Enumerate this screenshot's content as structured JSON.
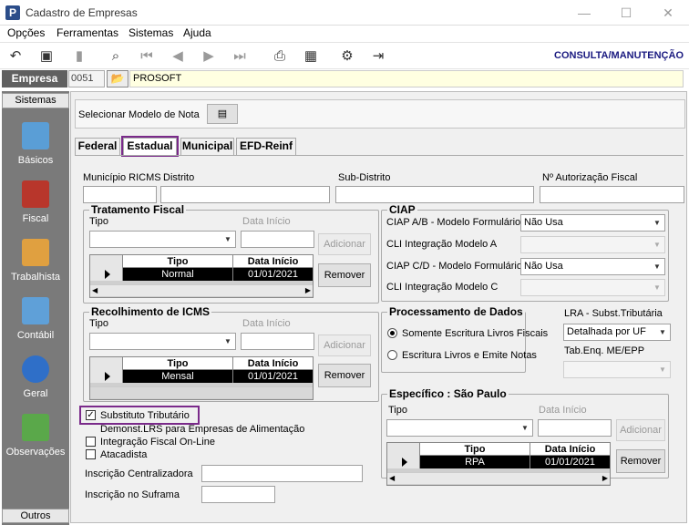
{
  "window": {
    "title": "Cadastro de Empresas",
    "app_glyph": "P"
  },
  "menu": [
    "Opções",
    "Ferramentas",
    "Sistemas",
    "Ajuda"
  ],
  "toolbar": {
    "mode_label": "CONSULTA/MANUTENÇÃO"
  },
  "empresa": {
    "label": "Empresa",
    "code": "0051",
    "name": "PROSOFT"
  },
  "sidebar": {
    "header": "Sistemas",
    "items": [
      "Básicos",
      "Fiscal",
      "Trabalhista",
      "Contábil",
      "Geral",
      "Observações"
    ],
    "footer": "Outros"
  },
  "model": {
    "label": "Selecionar Modelo de Nota"
  },
  "tabs": [
    "Federal",
    "Estadual",
    "Municipal",
    "EFD-Reinf"
  ],
  "top_fields": {
    "municipio": "Município RICMS",
    "distrito": "Distrito",
    "subdistrito": "Sub-Distrito",
    "autorizacao": "Nº Autorização Fiscal"
  },
  "tratamento": {
    "legend": "Tratamento Fiscal",
    "tipo_label": "Tipo",
    "data_label": "Data Início",
    "add": "Adicionar",
    "remove": "Remover",
    "cols": [
      "Tipo",
      "Data Início"
    ],
    "row": [
      "Normal",
      "01/01/2021"
    ]
  },
  "recolhimento": {
    "legend": "Recolhimento de ICMS",
    "tipo_label": "Tipo",
    "data_label": "Data Início",
    "add": "Adicionar",
    "remove": "Remover",
    "cols": [
      "Tipo",
      "Data Início"
    ],
    "row": [
      "Mensal",
      "01/01/2021"
    ]
  },
  "ciap": {
    "legend": "CIAP",
    "ab_label": "CIAP  A/B - Modelo Formulário",
    "ab_value": "Não Usa",
    "cli_a_label": "CLI Integração Modelo A",
    "cd_label": "CIAP C/D - Modelo Formulário",
    "cd_value": "Não Usa",
    "cli_c_label": "CLI Integração Modelo C"
  },
  "processamento": {
    "legend": "Processamento de Dados",
    "opt1": "Somente Escritura Livros Fiscais",
    "opt2": "Escritura Livros e Emite Notas"
  },
  "lra": {
    "label": "LRA - Subst.Tributária",
    "value": "Detalhada por UF",
    "tab_label": "Tab.Enq. ME/EPP"
  },
  "sp": {
    "legend": "Específico : São Paulo",
    "tipo_label": "Tipo",
    "data_label": "Data Início",
    "add": "Adicionar",
    "remove": "Remover",
    "cols": [
      "Tipo",
      "Data Início"
    ],
    "row": [
      "RPA",
      "01/01/2021"
    ]
  },
  "checks": {
    "subst": "Substituto Tributário",
    "demonst": "Demonst.LRS para Empresas de Alimentação",
    "integ": "Integração Fiscal On-Line",
    "atac": "Atacadista"
  },
  "bottom": {
    "centralizadora": "Inscrição Centralizadora",
    "suframa": "Inscrição no Suframa"
  }
}
